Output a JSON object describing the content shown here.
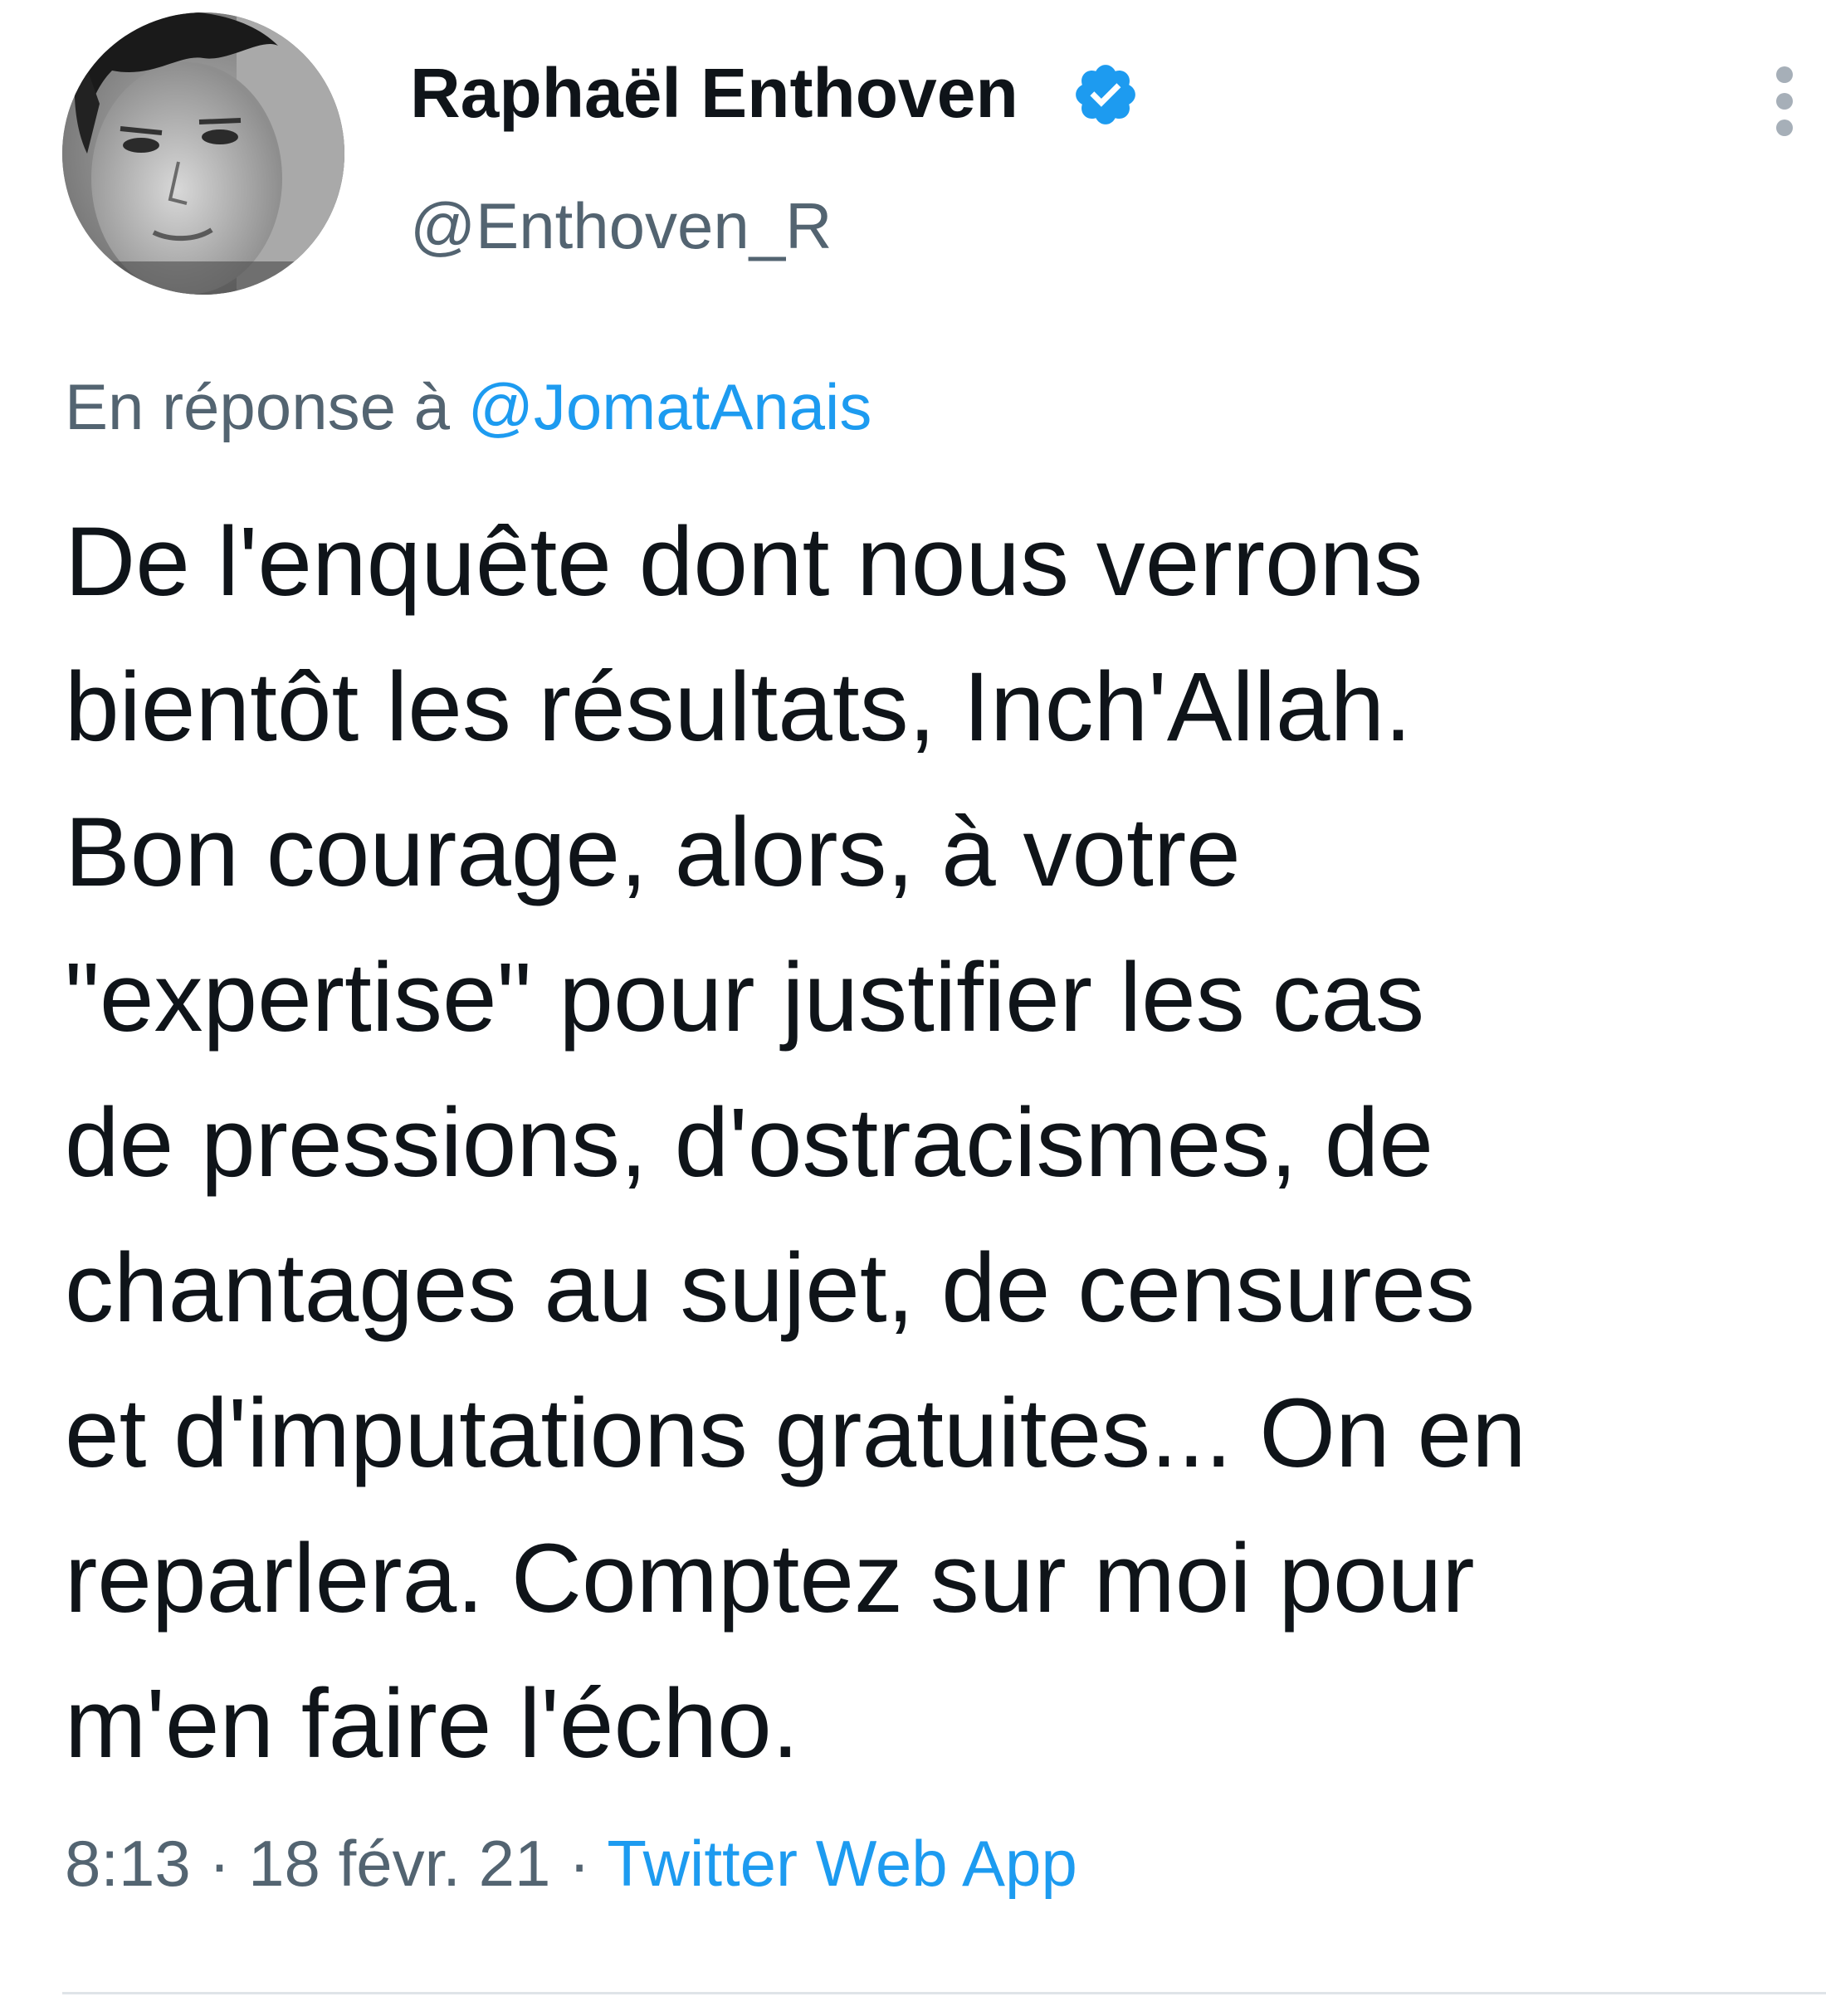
{
  "author": {
    "display_name": "Raphaël Enthoven",
    "handle": "@Enthoven_R",
    "verified": true
  },
  "reply": {
    "prefix": "En réponse à",
    "mention": "@JomatAnais"
  },
  "tweet": {
    "text": "De l'enquête dont nous verrons\nbientôt les résultats, Inch'Allah.\nBon courage, alors, à votre\n\"expertise\" pour justifier les cas\nde pressions, d'ostracismes, de\nchantages au sujet, de censures\net d'imputations gratuites... On en\nreparlera. Comptez sur moi pour\nm'en faire l'écho."
  },
  "meta": {
    "time": "8:13",
    "separator": "·",
    "date": "18 févr. 21",
    "source": "Twitter Web App"
  },
  "icons": {
    "verified": "verified-badge-icon",
    "more": "more-vertical-icon"
  },
  "colors": {
    "accent": "#1d9bf0",
    "secondary_text": "#536471",
    "primary_text": "#0f1419"
  }
}
